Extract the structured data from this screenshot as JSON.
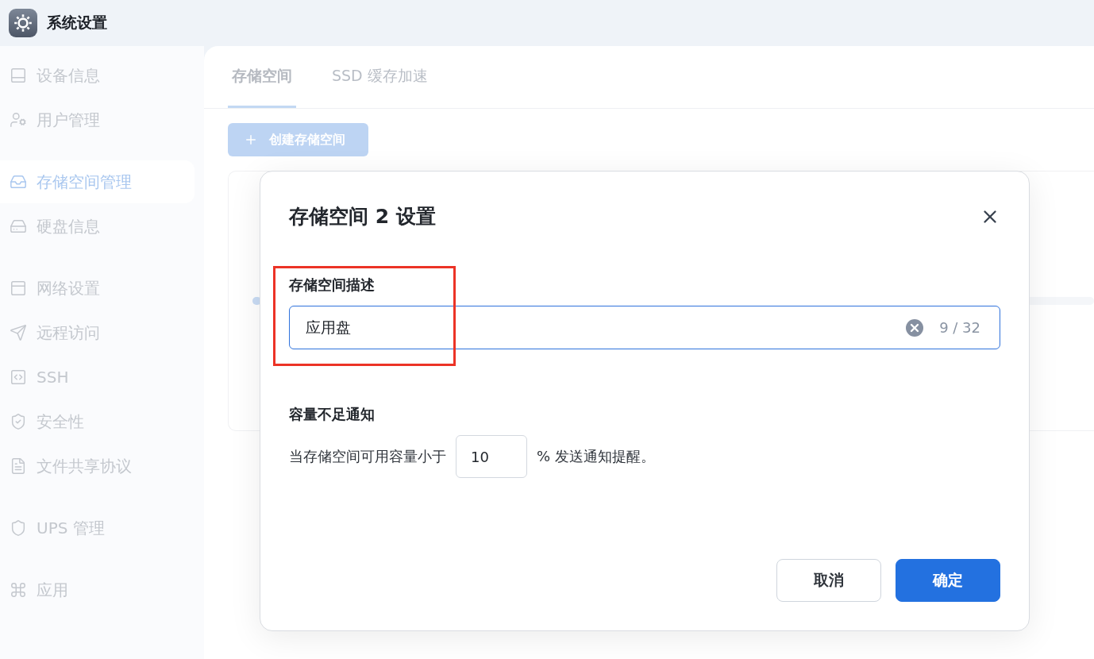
{
  "window": {
    "title": "系统设置"
  },
  "sidebar": {
    "groups": [
      [
        {
          "label": "设备信息",
          "selected": false
        },
        {
          "label": "用户管理",
          "selected": false
        }
      ],
      [
        {
          "label": "存储空间管理",
          "selected": true
        },
        {
          "label": "硬盘信息",
          "selected": false
        }
      ],
      [
        {
          "label": "网络设置",
          "selected": false
        },
        {
          "label": "远程访问",
          "selected": false
        },
        {
          "label": "SSH",
          "selected": false
        },
        {
          "label": "安全性",
          "selected": false
        },
        {
          "label": "文件共享协议",
          "selected": false
        }
      ],
      [
        {
          "label": "UPS 管理",
          "selected": false
        }
      ],
      [
        {
          "label": "应用",
          "selected": false
        }
      ]
    ]
  },
  "tabs": [
    {
      "label": "存储空间",
      "selected": true
    },
    {
      "label": "SSD 缓存加速",
      "selected": false
    }
  ],
  "create_button": {
    "label": "创建存储空间"
  },
  "storage_card": {
    "usage": {
      "level": 0.01
    }
  },
  "dialog": {
    "title": "存储空间 2 设置",
    "description": {
      "label": "存储空间描述",
      "value": "应用盘",
      "counter": "9 / 32"
    },
    "notification": {
      "label": "容量不足通知",
      "before": "当存储空间可用容量小于",
      "value": "10",
      "after": "% 发送通知提醒。"
    },
    "buttons": [
      {
        "label": "取消",
        "kind": "secondary"
      },
      {
        "label": "确定",
        "kind": "primary"
      }
    ]
  }
}
